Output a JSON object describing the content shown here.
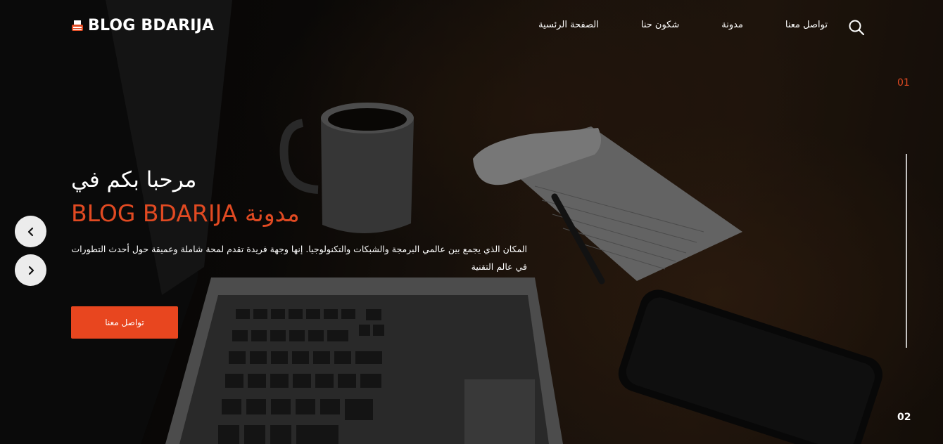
{
  "header": {
    "logo_text": "BLOG BDARIJA",
    "logo_icon": "typewriter-icon",
    "nav": [
      {
        "label": "الصفحة الرئسية"
      },
      {
        "label": "شكون حنا"
      },
      {
        "label": "مدونة"
      },
      {
        "label": "تواصل معنا"
      }
    ],
    "search_icon": "search-icon"
  },
  "hero": {
    "headline_line1": "مرحبا بكم في",
    "headline_line2": "BLOG BDARIJA مدونة",
    "description": "المكان الذي يجمع بين عالمي البرمجة والشبكات والتكنولوجيا. إنها وجهة فريدة تقدم لمحة شاملة وعميقة حول أحدث التطورات في عالم التقنية",
    "cta_label": "تواصل معنا"
  },
  "slider": {
    "current": "01",
    "next": "02",
    "prev_icon": "chevron-left-icon",
    "next_icon": "chevron-right-icon"
  },
  "colors": {
    "accent": "#e8461f",
    "accent_text": "#e14a22",
    "text": "#ffffff"
  }
}
